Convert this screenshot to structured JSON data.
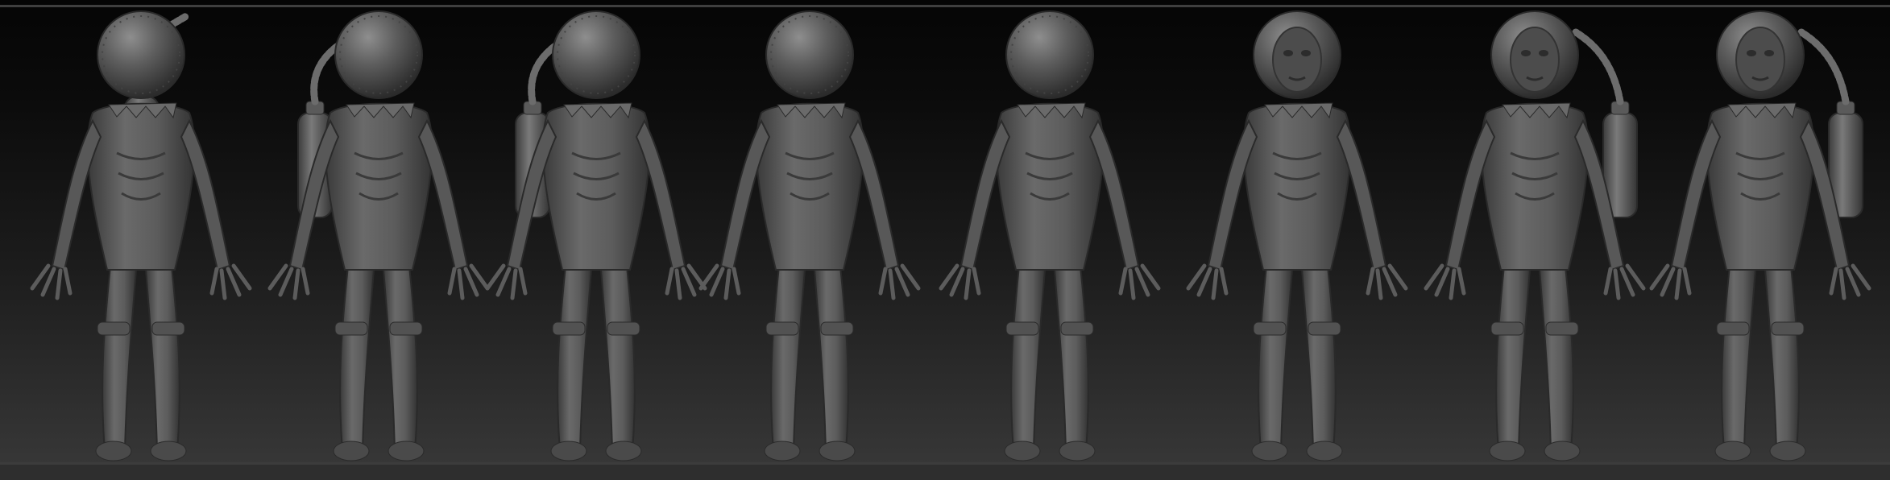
{
  "scene": {
    "subject": "turnaround",
    "views": [
      {
        "id": "back",
        "helmet": "opaque",
        "tank": "center"
      },
      {
        "id": "back-three-quarter",
        "helmet": "opaque",
        "tank": "left"
      },
      {
        "id": "side-left",
        "helmet": "opaque",
        "tank": "left"
      },
      {
        "id": "front-three-quarter-left",
        "helmet": "opaque",
        "tank": "hidden"
      },
      {
        "id": "front-visor",
        "helmet": "opaque",
        "tank": "hidden"
      },
      {
        "id": "front-face",
        "helmet": "open-face",
        "tank": "hidden"
      },
      {
        "id": "front-three-quarter-right",
        "helmet": "open-face",
        "tank": "right"
      },
      {
        "id": "side-right",
        "helmet": "open-face",
        "tank": "right"
      }
    ],
    "colors": {
      "background_top": "#050505",
      "background_bottom": "#3a3a3a",
      "clay": "#5a5a5a",
      "clay_highlight": "#8a8a8a",
      "clay_shadow": "#2a2a2a"
    }
  }
}
